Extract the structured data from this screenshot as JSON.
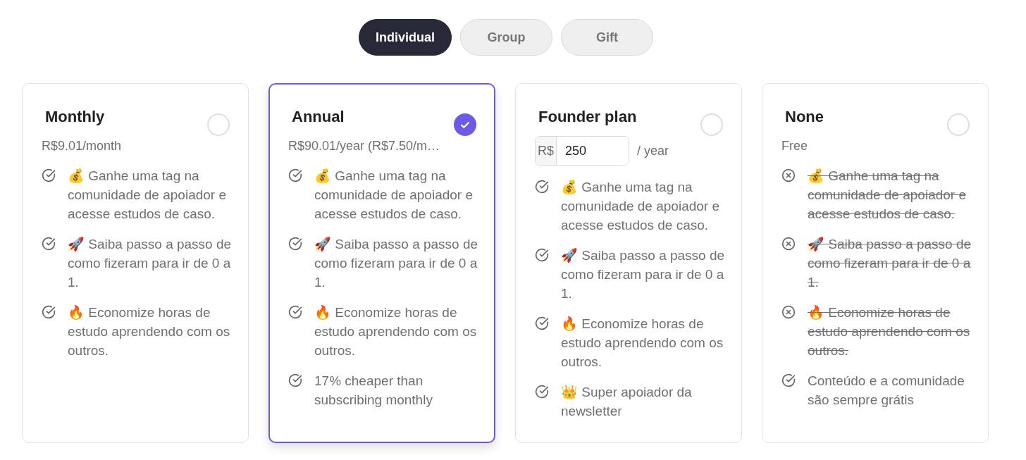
{
  "tabs": [
    {
      "label": "Individual",
      "selected": true
    },
    {
      "label": "Group",
      "selected": false
    },
    {
      "label": "Gift",
      "selected": false
    }
  ],
  "plans": [
    {
      "title": "Monthly",
      "selected": false,
      "price": {
        "kind": "text",
        "text": "R$9.01/month"
      },
      "features": [
        {
          "text": "💰 Ganhe uma tag na comunidade de apoiador e acesse estudos de caso.",
          "included": true
        },
        {
          "text": "🚀 Saiba passo a passo de como fizeram para ir de 0 a 1.",
          "included": true
        },
        {
          "text": "🔥 Economize horas de estudo aprendendo com os outros.",
          "included": true
        }
      ]
    },
    {
      "title": "Annual",
      "selected": true,
      "price": {
        "kind": "text",
        "text": "R$90.01/year (R$7.50/m…"
      },
      "features": [
        {
          "text": "💰 Ganhe uma tag na comunidade de apoiador e acesse estudos de caso.",
          "included": true
        },
        {
          "text": "🚀 Saiba passo a passo de como fizeram para ir de 0 a 1.",
          "included": true
        },
        {
          "text": "🔥 Economize horas de estudo aprendendo com os outros.",
          "included": true
        },
        {
          "text": "17% cheaper than subscribing monthly",
          "included": true
        }
      ]
    },
    {
      "title": "Founder plan",
      "selected": false,
      "price": {
        "kind": "input",
        "prefix": "R$",
        "value": "250",
        "suffix": "/ year"
      },
      "features": [
        {
          "text": "💰 Ganhe uma tag na comunidade de apoiador e acesse estudos de caso.",
          "included": true
        },
        {
          "text": "🚀 Saiba passo a passo de como fizeram para ir de 0 a 1.",
          "included": true
        },
        {
          "text": "🔥 Economize horas de estudo aprendendo com os outros.",
          "included": true
        },
        {
          "text": "👑 Super apoiador da newsletter",
          "included": true
        }
      ]
    },
    {
      "title": "None",
      "selected": false,
      "price": {
        "kind": "text",
        "text": "Free"
      },
      "features": [
        {
          "text": "💰 Ganhe uma tag na comunidade de apoiador e acesse estudos de caso.",
          "included": false
        },
        {
          "text": "🚀 Saiba passo a passo de como fizeram para ir de 0 a 1.",
          "included": false
        },
        {
          "text": "🔥 Economize horas de estudo aprendendo com os outros.",
          "included": false
        },
        {
          "text": "Conteúdo e a comunidade são sempre grátis",
          "included": true
        }
      ]
    }
  ]
}
